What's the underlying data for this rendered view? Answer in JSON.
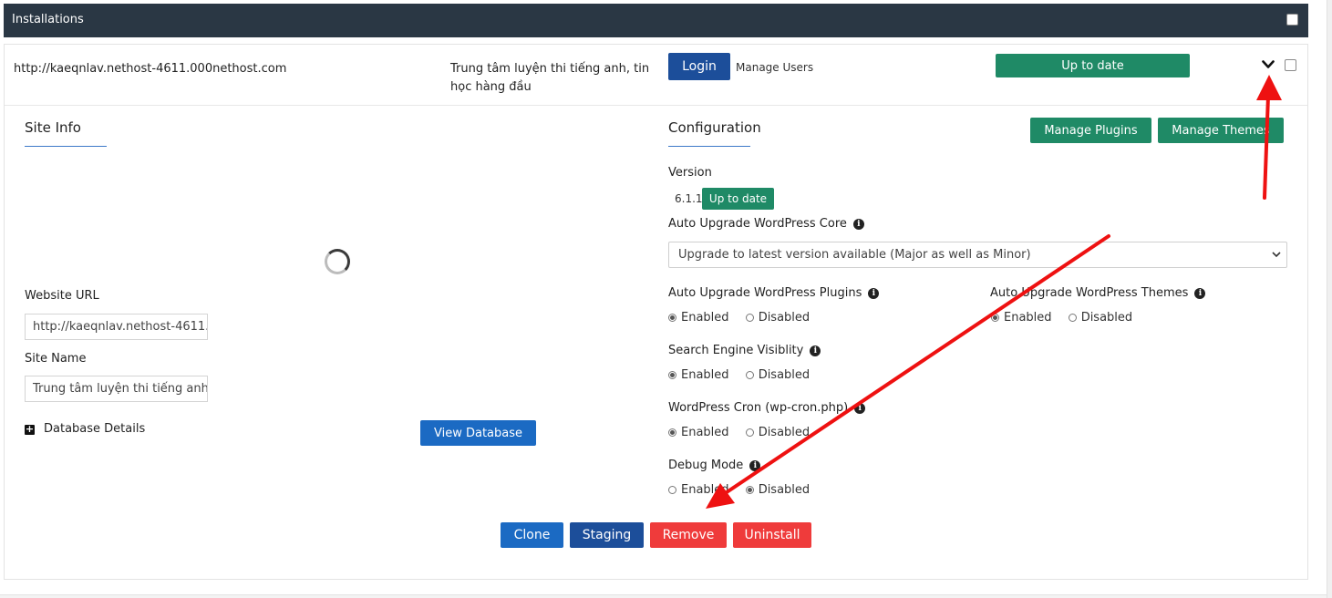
{
  "header": {
    "title": "Installations"
  },
  "install": {
    "url": "http://kaeqnlav.nethost-4611.000nethost.com",
    "site_title_line1": "Trung tâm luyện thi tiếng anh, tin",
    "site_title_line2": "học hàng đầu",
    "login_label": "Login",
    "manage_users_label": "Manage Users",
    "status_label": "Up to date"
  },
  "site_info": {
    "title": "Site Info",
    "website_url_label": "Website URL",
    "website_url_value": "http://kaeqnlav.nethost-4611.",
    "site_name_label": "Site Name",
    "site_name_value": "Trung tâm luyện thi tiếng anh",
    "database_details_label": "Database Details",
    "view_database_label": "View Database"
  },
  "configuration": {
    "title": "Configuration",
    "manage_plugins_label": "Manage Plugins",
    "manage_themes_label": "Manage Themes",
    "version_label": "Version",
    "version_value": "6.1.1",
    "version_status": "Up to date",
    "auto_upgrade_core_label": "Auto Upgrade WordPress Core",
    "auto_upgrade_core_selected": "Upgrade to latest version available (Major as well as Minor)",
    "auto_upgrade_plugins_label": "Auto Upgrade WordPress Plugins",
    "auto_upgrade_themes_label": "Auto Upgrade WordPress Themes",
    "search_engine_label": "Search Engine Visiblity",
    "cron_label": "WordPress Cron (wp-cron.php)",
    "debug_label": "Debug Mode",
    "enabled": "Enabled",
    "disabled": "Disabled"
  },
  "actions": {
    "clone": "Clone",
    "staging": "Staging",
    "remove": "Remove",
    "uninstall": "Uninstall"
  },
  "colors": {
    "header_bg": "#2a3744",
    "navy": "#1c4e9a",
    "blue": "#1b6ac3",
    "green": "#1f8a66",
    "red": "#ef3b3b",
    "annotation_arrow": "#ee1111"
  }
}
